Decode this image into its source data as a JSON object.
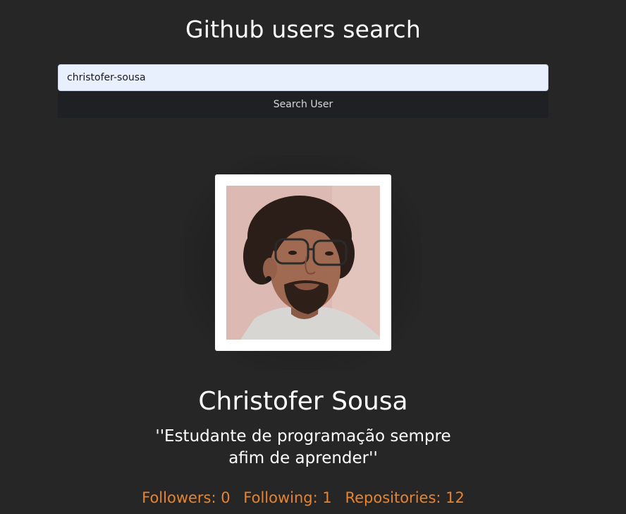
{
  "header": {
    "title": "Github users search"
  },
  "search": {
    "value": "christofer-sousa",
    "button_label": "Search User"
  },
  "profile": {
    "name": "Christofer Sousa",
    "bio": "''Estudante de programação sempre afim de aprender''",
    "avatar_icon": "user-avatar-photo",
    "stats": {
      "followers": "Followers: 0",
      "following": "Following: 1",
      "repositories": "Repositories: 12"
    }
  },
  "colors": {
    "background": "#262626",
    "accent": "#e8832f",
    "input_background": "#e8f0fe",
    "button_background": "#1f2023"
  }
}
